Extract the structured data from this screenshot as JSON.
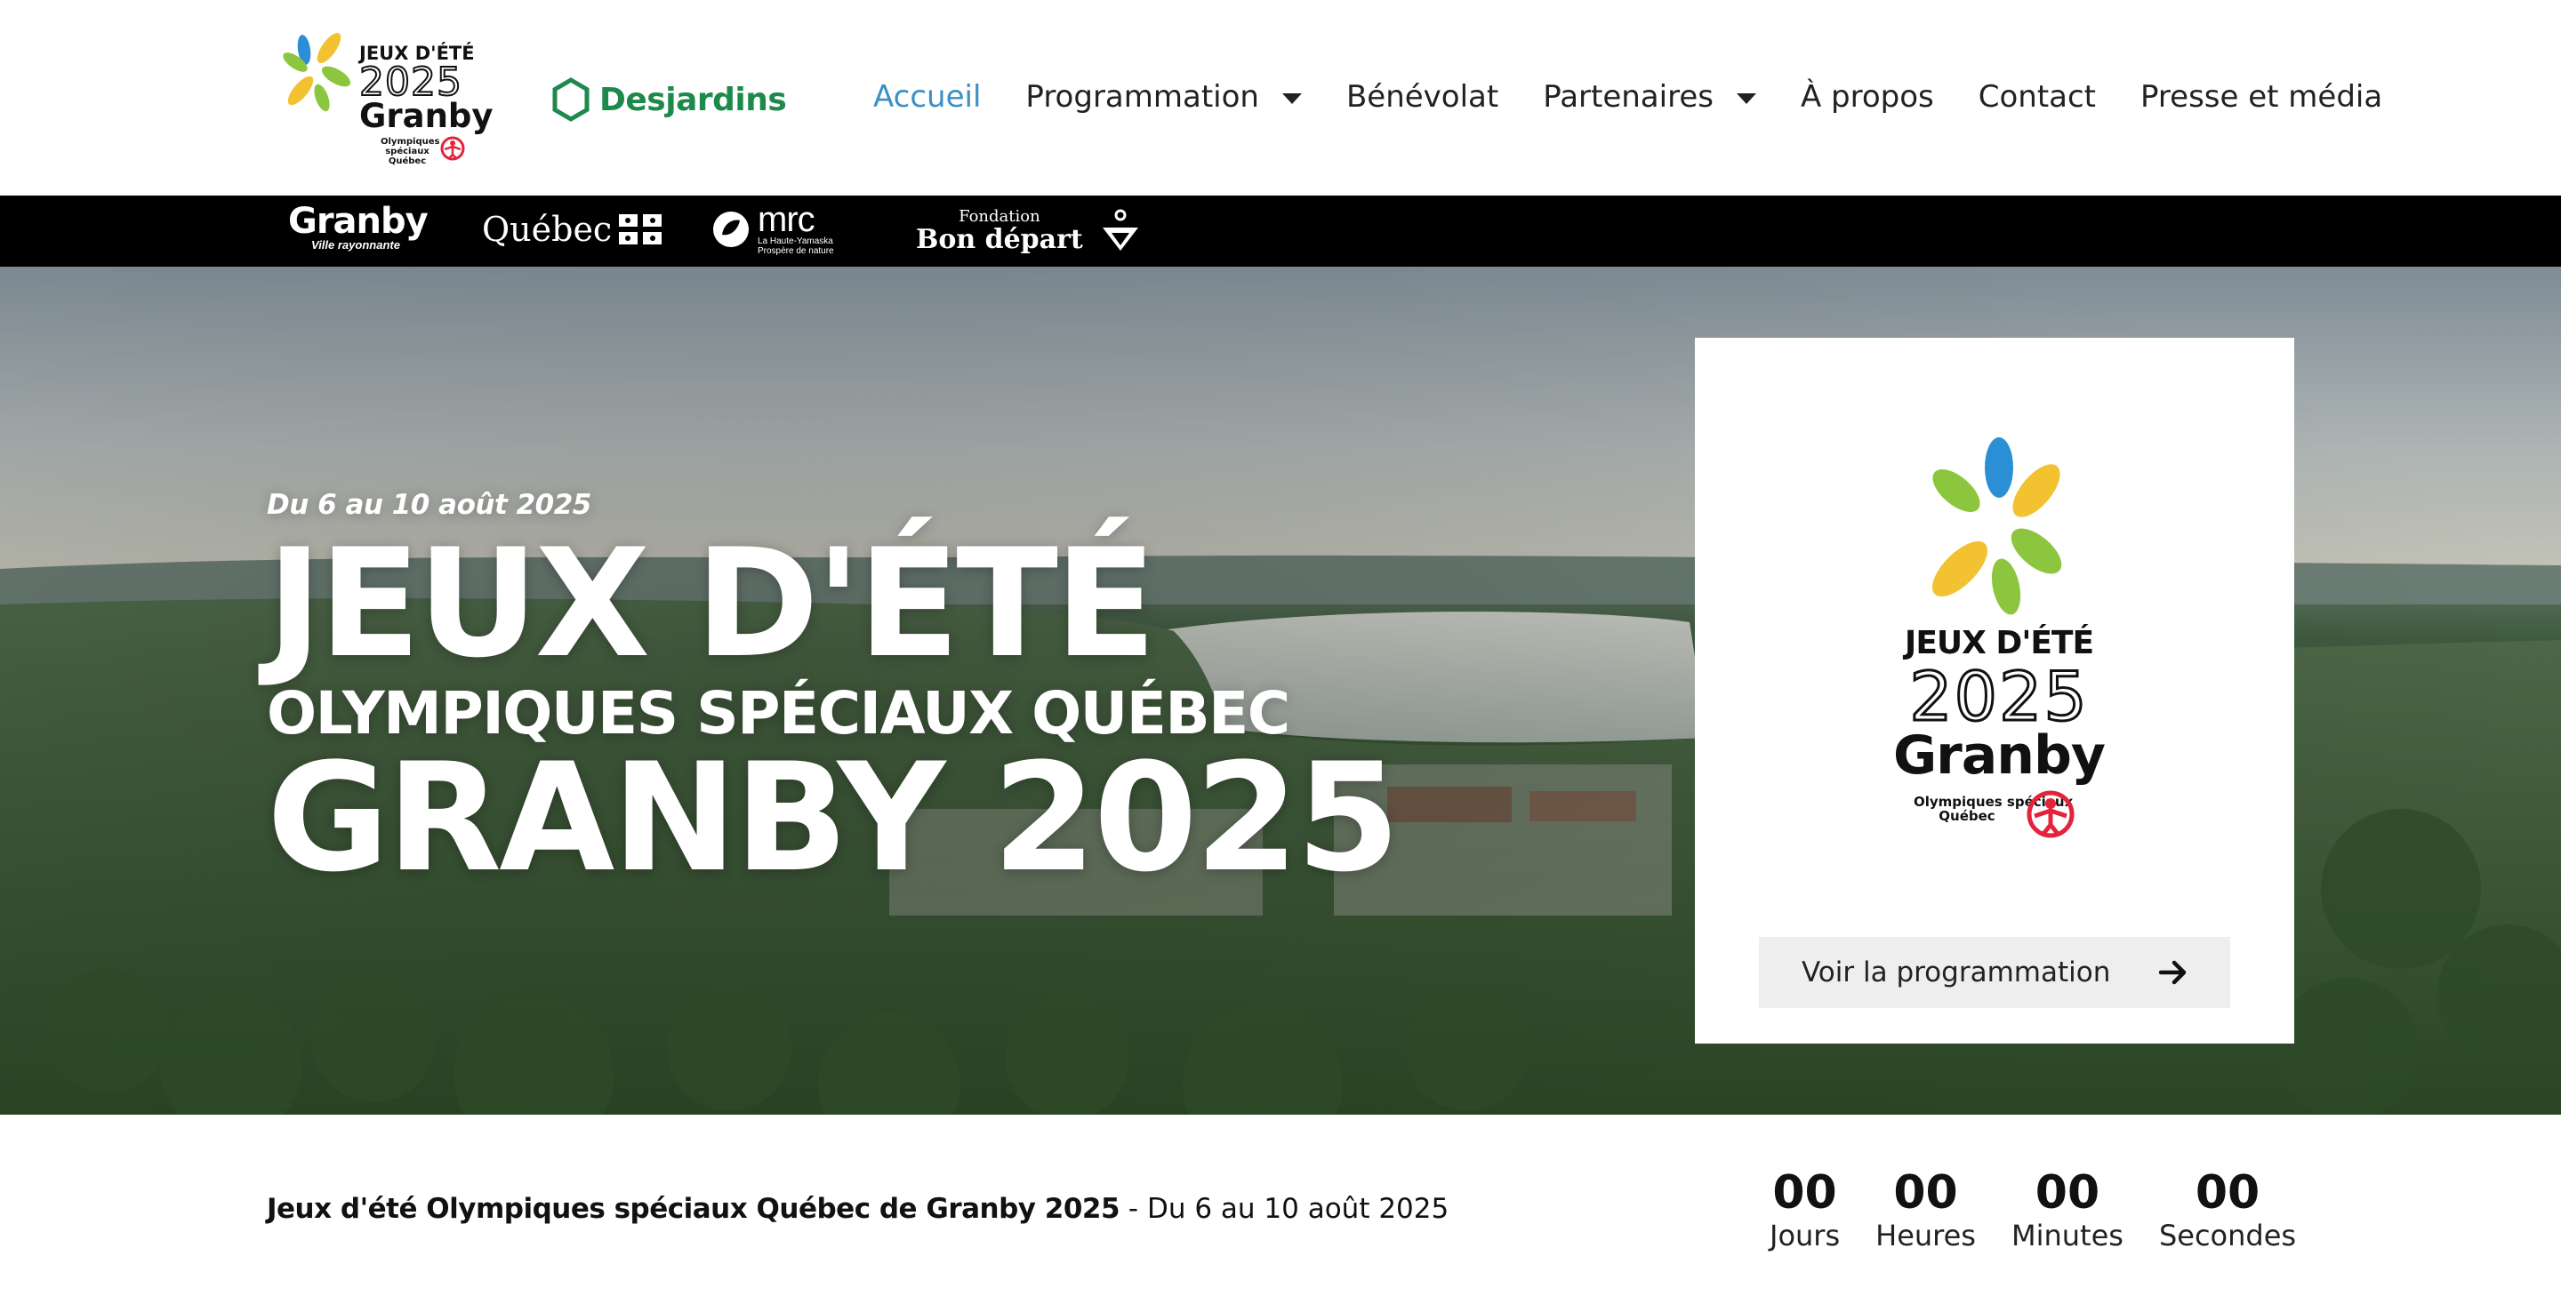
{
  "header": {
    "logo": {
      "line1": "JEUX D'ÉTÉ",
      "line2": "2025",
      "line3": "Granby",
      "line4": "Olympiques spéciaux Québec"
    },
    "sponsor": "Desjardins",
    "nav": [
      {
        "label": "Accueil",
        "active": true
      },
      {
        "label": "Programmation",
        "dropdown": true
      },
      {
        "label": "Bénévolat"
      },
      {
        "label": "Partenaires",
        "dropdown": true
      },
      {
        "label": "À propos"
      },
      {
        "label": "Contact"
      },
      {
        "label": "Presse et média"
      }
    ]
  },
  "partners": {
    "granby": {
      "name": "Granby",
      "tagline": "Ville rayonnante"
    },
    "quebec": {
      "name": "Québec"
    },
    "mrc": {
      "name": "mrc",
      "sub1": "La Haute-Yamaska",
      "sub2": "Prospère de nature"
    },
    "fondation": {
      "line1": "Fondation",
      "line2": "Bon départ"
    }
  },
  "hero": {
    "date": "Du 6 au 10 août 2025",
    "line1": "JEUX D'ÉTÉ",
    "line2": "OLYMPIQUES SPÉCIAUX QUÉBEC",
    "line3": "GRANBY 2025",
    "card": {
      "logo_line1": "JEUX D'ÉTÉ",
      "logo_line2": "2025",
      "logo_line3": "Granby",
      "logo_line4": "Olympiques spéciaux",
      "logo_line5": "Québec",
      "cta_label": "Voir la programmation"
    }
  },
  "strip": {
    "event_name": "Jeux d'été Olympiques spéciaux Québec de Granby 2025",
    "event_dates": " - Du 6 au 10 août 2025",
    "countdown": [
      {
        "value": "00",
        "label": "Jours"
      },
      {
        "value": "00",
        "label": "Heures"
      },
      {
        "value": "00",
        "label": "Minutes"
      },
      {
        "value": "00",
        "label": "Secondes"
      }
    ]
  },
  "colors": {
    "nav_active": "#3a8fc7",
    "desjardins_green": "#1d8a4c",
    "petal_green": "#8cc63f",
    "petal_yellow": "#f2c230",
    "petal_blue": "#2b8fd6",
    "special_olympics_red": "#e2233b"
  }
}
